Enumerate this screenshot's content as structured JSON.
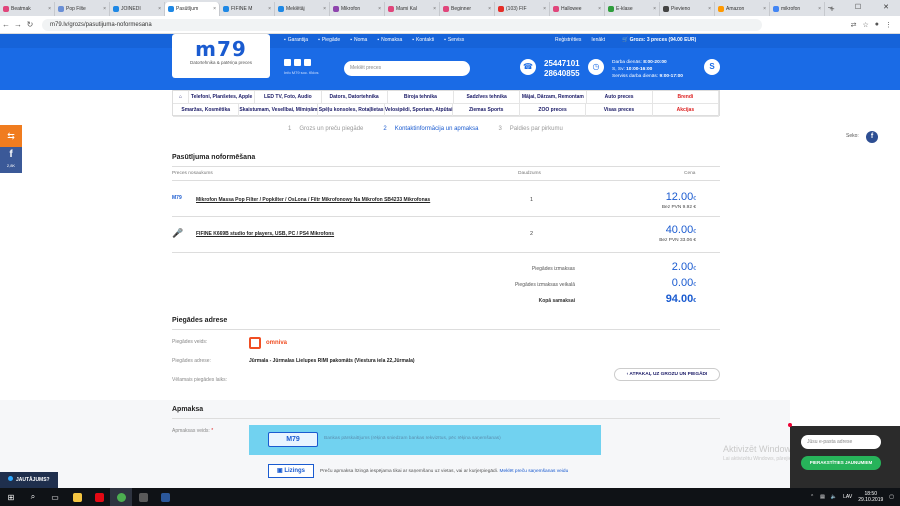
{
  "browser": {
    "tabs": [
      {
        "label": "Beatmak",
        "color": "#e0457b"
      },
      {
        "label": "Pop Filte",
        "color": "#6a8fd6"
      },
      {
        "label": "JOINEDI",
        "color": "#1e88e5"
      },
      {
        "label": "Pasūtījum",
        "color": "#1e88e5",
        "active": true
      },
      {
        "label": "FIFINE M",
        "color": "#1e88e5"
      },
      {
        "label": "Meklētāj",
        "color": "#1e88e5"
      },
      {
        "label": "Mikrofon",
        "color": "#8e44ad"
      },
      {
        "label": "Mami Kal",
        "color": "#e0457b"
      },
      {
        "label": "Beginner",
        "color": "#e0457b"
      },
      {
        "label": "(103) FIF",
        "color": "#e52d27"
      },
      {
        "label": "Hallowee",
        "color": "#e0457b"
      },
      {
        "label": "E-klase",
        "color": "#2e9d3c"
      },
      {
        "label": "Pievieno",
        "color": "#444444"
      },
      {
        "label": "Amazon",
        "color": "#ff9900"
      },
      {
        "label": "mikrofon",
        "color": "#4285f4"
      }
    ],
    "new_tab": "+",
    "url": "m79.lv/grozs/pasutijuma-noformesana",
    "win_min": "–",
    "win_max": "☐",
    "win_close": "✕"
  },
  "header": {
    "logo": "m79",
    "logo_sub": "Datortehnika & patēriņa preces",
    "topnav": [
      "Garantija",
      "Piegāde",
      "Noma",
      "Nomaksa",
      "Kontakti",
      "Serviss"
    ],
    "register": "Reģistrēties",
    "login": "Ienākt",
    "cart": "Grozs: 3 preces (94.00 EUR)",
    "social_text": "Info M79 soc. tīklos",
    "search_placeholder": "Meklēt preces",
    "phone1": "25447101",
    "phone2": "28640855",
    "hours1_label": "Darba dienās:",
    "hours1_value": "8:00-20:00",
    "hours2_label": "S, Sv:",
    "hours2_value": "10:00-16:00",
    "hours3_label": "Serviss darba dienās:",
    "hours3_value": "9:00-17:00"
  },
  "categories": {
    "row1": [
      "Telefoni, Planšetes, Apple",
      "LED TV, Foto, Audio",
      "Dators, Datortehnika",
      "Biroja tehnika",
      "Sadzīves tehnika",
      "Mājai, Dārzam, Remontam",
      "Auto preces",
      "Brendi"
    ],
    "row2": [
      "Smaržas, Kosmētika",
      "Skaistumam, Veselībai, Mīmiņām",
      "Spēļu konsoles, Rotaļlietas",
      "Velosipēdi, Sportam, Atpūtai",
      "Ziemas Sports",
      "ZOO preces",
      "Visas preces",
      "Akcijas"
    ]
  },
  "side": {
    "fb_count": "2,8K"
  },
  "steps": [
    {
      "num": "1",
      "label": "Grozs un preču piegāde"
    },
    {
      "num": "2",
      "label": "Kontaktinformācija un apmaksa",
      "active": true
    },
    {
      "num": "3",
      "label": "Paldies par pirkumu"
    }
  ],
  "share_label": "Seko:",
  "order": {
    "title": "Pasūtījuma noformēšana",
    "col_name": "Preces nosaukums",
    "col_qty": "Daudzums",
    "col_price": "Cena",
    "items": [
      {
        "name": "Mikrofon Massa Pop Filter / Popkilter / OsLona / Filtr Mikrofonowy Na Mikrofon SB4233 Mikrofonas",
        "qty": "1",
        "price": "12.00",
        "vat": "Bez PVN 9.92 €"
      },
      {
        "name": "FIFINE K669B studio for players, USB, PC / PS4 Mikrofons",
        "qty": "2",
        "price": "40.00",
        "vat": "Bez PVN 33.06 €"
      }
    ],
    "currency": "€",
    "delivery_label": "Piegādes izmaksas",
    "delivery_value": "2.00",
    "lift_label": "Piegādes izmaksas veikalā",
    "lift_value": "0.00",
    "total_label": "Kopā samaksai",
    "total_value": "94.00"
  },
  "delivery": {
    "title": "Piegādes adrese",
    "type_label": "Piegādes veids:",
    "type_value": "omniva",
    "address_label": "Piegādes adrese:",
    "address_value": "Jūrmala - Jūrmalas Lielupes RIMI pakomāts (Viestura iela 22,Jūrmala)",
    "time_label": "Vēlamais piegādes laiks:",
    "back_button": "ATPAKAĻ UZ GROZU UN PIEGĀDI"
  },
  "payment": {
    "title": "Apmaksa",
    "type_label": "Apmaksas veids:",
    "m79_logo": "M79",
    "m79_text": "Bankas pārskaitījums (rēķinā sniedzam bankas rekvizītus, pēc rēķina saņemšanas)",
    "lizings": "Lizings",
    "lizings_text": "Preču apmaksa līzingā iespējama tikai ar saņemšanu uz vietas, vai ar kurjerpiegādi.",
    "lizings_link": "Meklēt preču saņemšanas veidu"
  },
  "watermark": {
    "line1": "Aktivizēt Windows",
    "line2": "Lai aktivizētu Windows, pārejiet uz"
  },
  "newsletter": {
    "placeholder": "Jūsu e-pasta adrese",
    "button": "PIERAKSTĪTIES JAUNUMIEM"
  },
  "chat_label": "JAUTĀJUMS?",
  "taskbar": {
    "lang": "LAV",
    "time": "18:50",
    "date": "29.10.2019"
  }
}
